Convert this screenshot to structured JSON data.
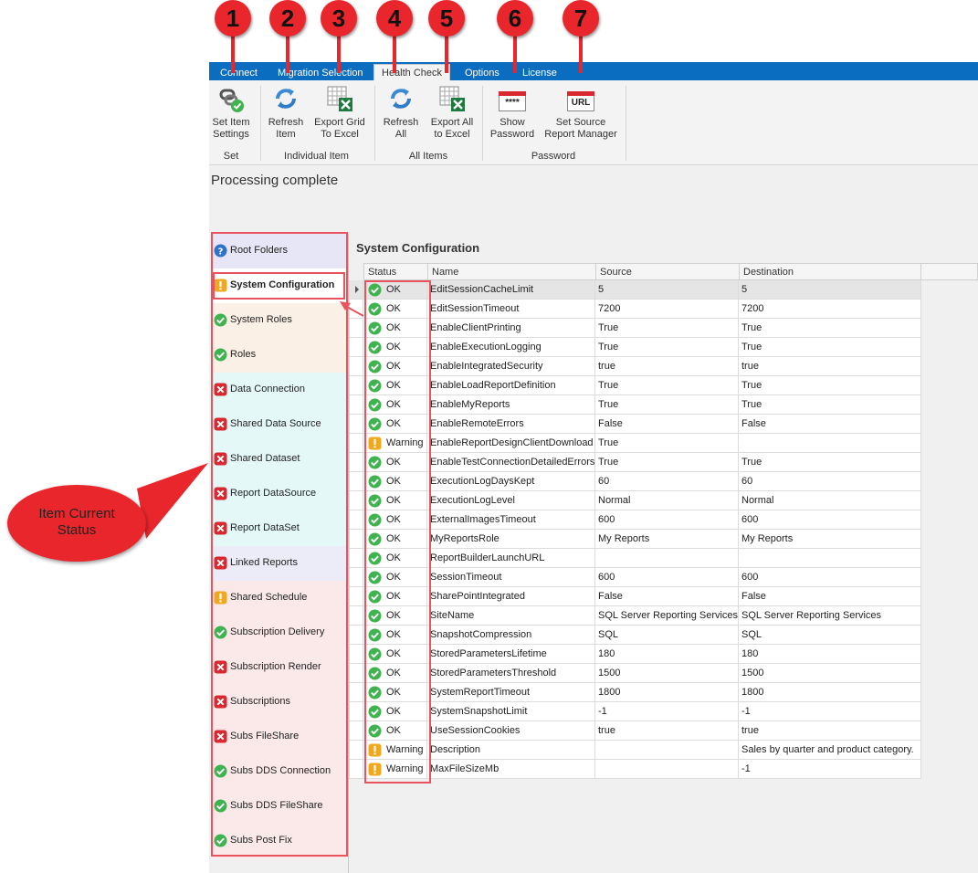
{
  "tabs": [
    {
      "label": "Connect",
      "active": false
    },
    {
      "label": "Migration Selection",
      "active": false
    },
    {
      "label": "Health Check",
      "active": true
    },
    {
      "label": "Options",
      "active": false
    },
    {
      "label": "License",
      "active": false
    }
  ],
  "ribbon": {
    "buttons": [
      {
        "line1": "Set Item",
        "line2": "Settings",
        "icon": "chain-check-icon",
        "marker": "1"
      },
      {
        "line1": "Refresh",
        "line2": "Item",
        "icon": "refresh-icon",
        "marker": "2"
      },
      {
        "line1": "Export Grid",
        "line2": "To Excel",
        "icon": "excel-export-icon",
        "marker": "3"
      },
      {
        "line1": "Refresh",
        "line2": "All",
        "icon": "refresh-icon",
        "marker": "4"
      },
      {
        "line1": "Export All",
        "line2": "to Excel",
        "icon": "excel-export-icon",
        "marker": "5"
      },
      {
        "line1": "Show",
        "line2": "Password",
        "icon": "password-icon",
        "marker": "6"
      },
      {
        "line1": "Set Source",
        "line2": "Report Manager",
        "icon": "url-icon",
        "marker": "7"
      }
    ],
    "groups": [
      "Set",
      "Individual Item",
      "All Items",
      "Password"
    ],
    "password_glyph": "****",
    "url_glyph": "URL"
  },
  "status_text": "Processing complete",
  "nav_items": [
    {
      "label": "Root Folders",
      "status": "question"
    },
    {
      "label": "System Configuration",
      "status": "warning"
    },
    {
      "label": "System Roles",
      "status": "ok"
    },
    {
      "label": "Roles",
      "status": "ok"
    },
    {
      "label": "Data Connection",
      "status": "error"
    },
    {
      "label": "Shared Data Source",
      "status": "error"
    },
    {
      "label": "Shared Dataset",
      "status": "error"
    },
    {
      "label": "Report DataSource",
      "status": "error"
    },
    {
      "label": "Report DataSet",
      "status": "error"
    },
    {
      "label": "Linked Reports",
      "status": "error"
    },
    {
      "label": "Shared Schedule",
      "status": "warning"
    },
    {
      "label": "Subscription Delivery",
      "status": "ok"
    },
    {
      "label": "Subscription Render",
      "status": "error"
    },
    {
      "label": "Subscriptions",
      "status": "error"
    },
    {
      "label": "Subs FileShare",
      "status": "error"
    },
    {
      "label": "Subs DDS Connection",
      "status": "ok"
    },
    {
      "label": "Subs DDS FileShare",
      "status": "ok"
    },
    {
      "label": "Subs Post Fix",
      "status": "ok"
    }
  ],
  "grid": {
    "title": "System Configuration",
    "columns": [
      "Status",
      "Name",
      "Source",
      "Destination"
    ],
    "rows": [
      {
        "status": "OK",
        "name": "EditSessionCacheLimit",
        "source": "5",
        "destination": "5"
      },
      {
        "status": "OK",
        "name": "EditSessionTimeout",
        "source": "7200",
        "destination": "7200"
      },
      {
        "status": "OK",
        "name": "EnableClientPrinting",
        "source": "True",
        "destination": "True"
      },
      {
        "status": "OK",
        "name": "EnableExecutionLogging",
        "source": "True",
        "destination": "True"
      },
      {
        "status": "OK",
        "name": "EnableIntegratedSecurity",
        "source": "true",
        "destination": "true"
      },
      {
        "status": "OK",
        "name": "EnableLoadReportDefinition",
        "source": "True",
        "destination": "True"
      },
      {
        "status": "OK",
        "name": "EnableMyReports",
        "source": "True",
        "destination": "True"
      },
      {
        "status": "OK",
        "name": "EnableRemoteErrors",
        "source": "False",
        "destination": "False"
      },
      {
        "status": "Warning",
        "name": "EnableReportDesignClientDownload",
        "source": "True",
        "destination": ""
      },
      {
        "status": "OK",
        "name": "EnableTestConnectionDetailedErrors",
        "source": "True",
        "destination": "True"
      },
      {
        "status": "OK",
        "name": "ExecutionLogDaysKept",
        "source": "60",
        "destination": "60"
      },
      {
        "status": "OK",
        "name": "ExecutionLogLevel",
        "source": "Normal",
        "destination": "Normal"
      },
      {
        "status": "OK",
        "name": "ExternalImagesTimeout",
        "source": "600",
        "destination": "600"
      },
      {
        "status": "OK",
        "name": "MyReportsRole",
        "source": "My Reports",
        "destination": "My Reports"
      },
      {
        "status": "OK",
        "name": "ReportBuilderLaunchURL",
        "source": "",
        "destination": ""
      },
      {
        "status": "OK",
        "name": "SessionTimeout",
        "source": "600",
        "destination": "600"
      },
      {
        "status": "OK",
        "name": "SharePointIntegrated",
        "source": "False",
        "destination": "False"
      },
      {
        "status": "OK",
        "name": "SiteName",
        "source": "SQL Server Reporting Services",
        "destination": "SQL Server Reporting Services"
      },
      {
        "status": "OK",
        "name": "SnapshotCompression",
        "source": "SQL",
        "destination": "SQL"
      },
      {
        "status": "OK",
        "name": "StoredParametersLifetime",
        "source": "180",
        "destination": "180"
      },
      {
        "status": "OK",
        "name": "StoredParametersThreshold",
        "source": "1500",
        "destination": "1500"
      },
      {
        "status": "OK",
        "name": "SystemReportTimeout",
        "source": "1800",
        "destination": "1800"
      },
      {
        "status": "OK",
        "name": "SystemSnapshotLimit",
        "source": "-1",
        "destination": "-1"
      },
      {
        "status": "OK",
        "name": "UseSessionCookies",
        "source": "true",
        "destination": "true"
      },
      {
        "status": "Warning",
        "name": "Description",
        "source": "",
        "destination": "Sales by quarter and product category."
      },
      {
        "status": "Warning",
        "name": "MaxFileSizeMb",
        "source": "",
        "destination": "-1"
      }
    ]
  },
  "callout": {
    "line1": "Item Current",
    "line2": "Status"
  },
  "colors": {
    "tab_bar": "#0b6dbf",
    "marker_red": "#e9262c",
    "annotation_red": "#e8535d",
    "ok_green": "#3fb34f",
    "warning_amber": "#f0a81c",
    "error_red": "#d9282f",
    "question_blue": "#2e73c8"
  }
}
